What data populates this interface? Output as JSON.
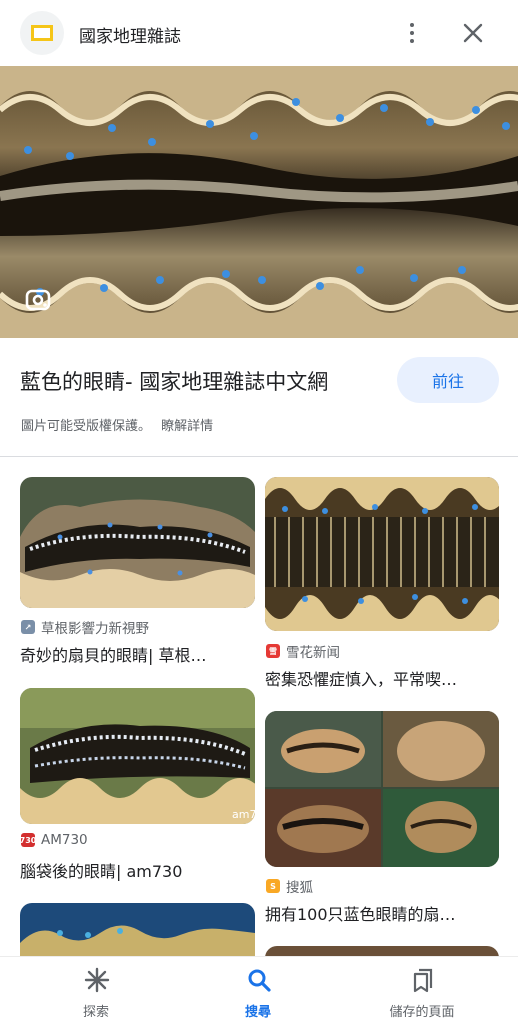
{
  "header": {
    "site_name": "國家地理雜誌",
    "logo_icon": "national-geographic-logo",
    "more_icon": "more-vert-icon",
    "close_icon": "close-icon"
  },
  "result": {
    "title": "藍色的眼睛- 國家地理雜誌中文網",
    "visit_label": "前往",
    "copyright_text": "圖片可能受版權保護。",
    "learn_more": "瞭解詳情",
    "lens_icon": "google-lens-icon"
  },
  "grid": [
    {
      "source": "草根影響力新視野",
      "caption": "奇妙的扇貝的眼睛| 草根…",
      "icon_color": "#7a8fa8"
    },
    {
      "source": "雪花新闻",
      "caption": "密集恐懼症慎入，平常喫…",
      "icon_color": "#e53935"
    },
    {
      "source": "AM730",
      "caption": "腦袋後的眼睛| am730",
      "icon_color": "#d32f2f"
    },
    {
      "source": "搜狐",
      "caption": "拥有100只蓝色眼睛的扇…",
      "icon_color": "#f9a825"
    }
  ],
  "bottom_nav": [
    {
      "label": "探索",
      "icon": "asterisk-icon"
    },
    {
      "label": "搜尋",
      "icon": "search-icon",
      "active": true
    },
    {
      "label": "儲存的頁面",
      "icon": "bookmark-icon"
    }
  ],
  "colors": {
    "accent": "#1a73e8",
    "accent_bg": "#e8f0fe"
  }
}
